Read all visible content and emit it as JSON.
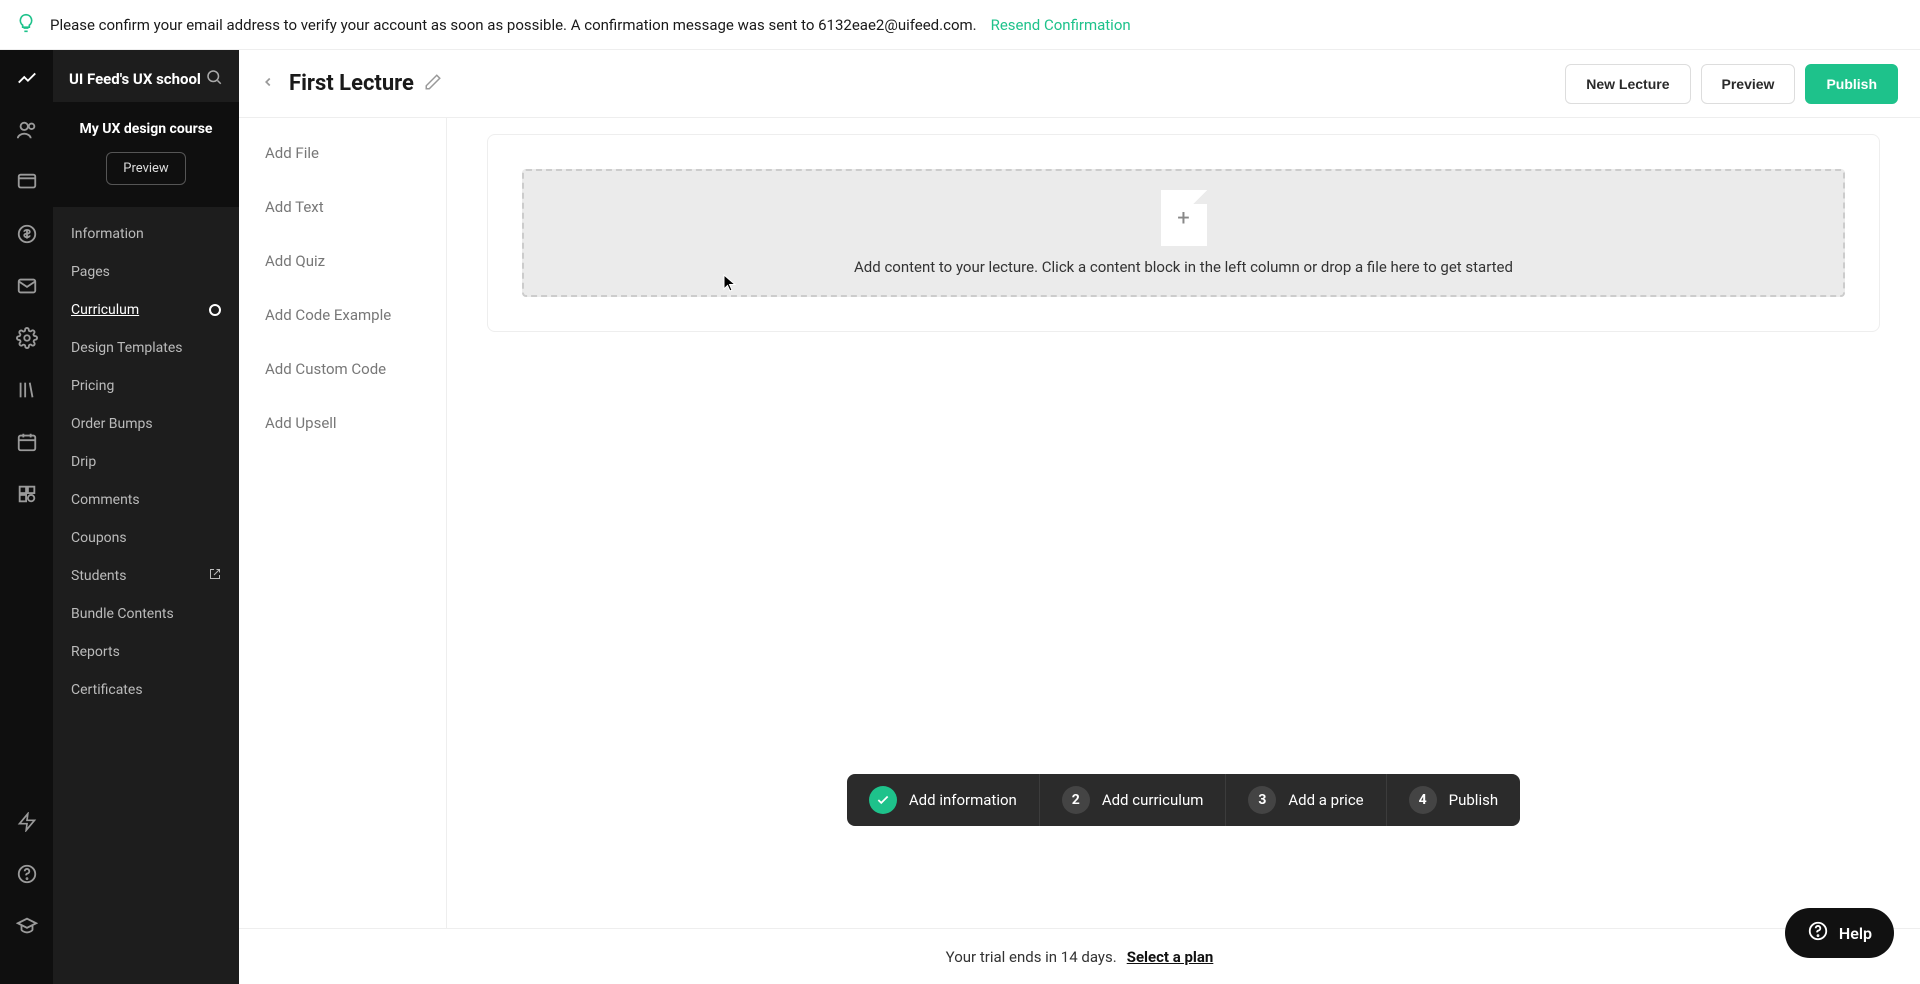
{
  "banner": {
    "message": "Please confirm your email address to verify your account as soon as possible. A confirmation message was sent to 6132eae2@uifeed.com.",
    "resend": "Resend Confirmation"
  },
  "sidebar": {
    "title": "UI Feed's UX school",
    "course_name": "My UX design course",
    "preview_btn": "Preview",
    "nav": [
      {
        "label": "Information"
      },
      {
        "label": "Pages"
      },
      {
        "label": "Curriculum",
        "active": true
      },
      {
        "label": "Design Templates"
      },
      {
        "label": "Pricing"
      },
      {
        "label": "Order Bumps"
      },
      {
        "label": "Drip"
      },
      {
        "label": "Comments"
      },
      {
        "label": "Coupons"
      },
      {
        "label": "Students",
        "external": true
      },
      {
        "label": "Bundle Contents"
      },
      {
        "label": "Reports"
      },
      {
        "label": "Certificates"
      }
    ]
  },
  "topbar": {
    "lecture_title": "First Lecture",
    "new_lecture": "New Lecture",
    "preview": "Preview",
    "publish": "Publish"
  },
  "add_items": [
    "Add File",
    "Add Text",
    "Add Quiz",
    "Add Code Example",
    "Add Custom Code",
    "Add Upsell"
  ],
  "dropzone": {
    "text": "Add content to your lecture. Click a content block in the left column or drop a file here to get started"
  },
  "steps": [
    {
      "label": "Add information",
      "done": true
    },
    {
      "num": "2",
      "label": "Add curriculum"
    },
    {
      "num": "3",
      "label": "Add a price"
    },
    {
      "num": "4",
      "label": "Publish"
    }
  ],
  "trial": {
    "message": "Your trial ends in 14 days.",
    "cta": "Select a plan"
  },
  "help": {
    "label": "Help"
  }
}
